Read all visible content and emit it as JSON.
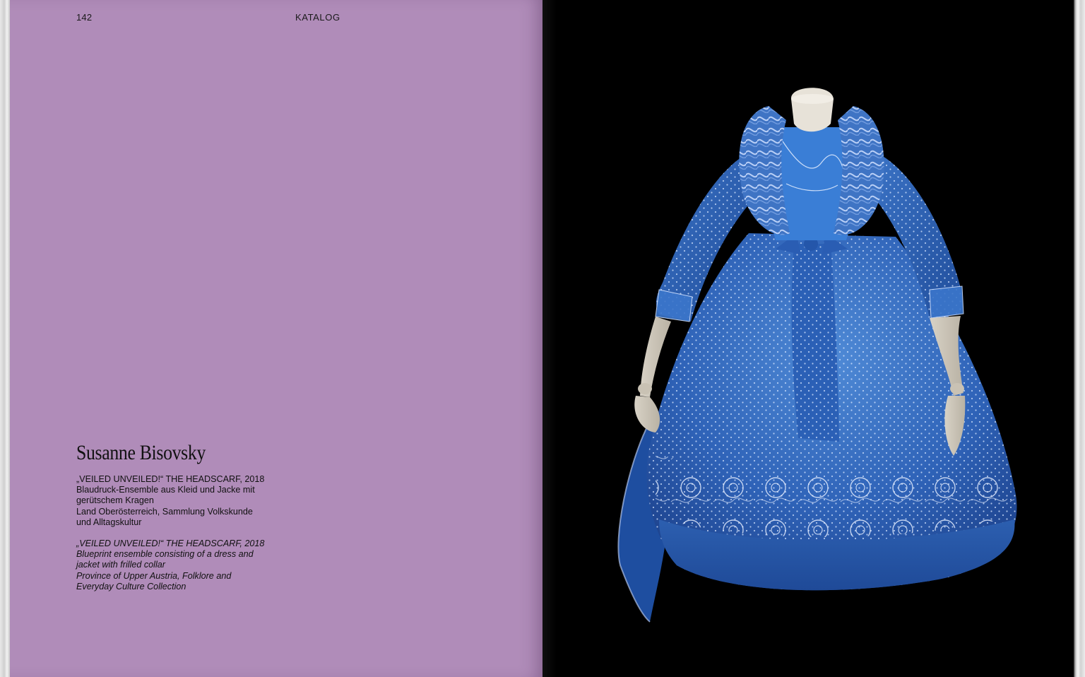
{
  "left_page": {
    "page_number": "142",
    "running_head": "KATALOG",
    "artist": "Susanne Bisovsky",
    "caption_de": [
      "„VEILED UNVEILED!“ THE HEADSCARF, 2018",
      "Blaudruck-Ensemble aus Kleid und Jacke mit",
      "gerütschem Kragen",
      "Land Oberösterreich, Sammlung Volkskunde",
      "und Alltagskultur"
    ],
    "caption_en": [
      "„VEILED UNVEILED!“ THE HEADSCARF, 2018",
      "Blueprint ensemble consisting of a dress and",
      "jacket with frilled collar",
      "Province of Upper Austria,  Folklore and",
      "Everyday Culture Collection"
    ],
    "background_color": "#b08cb9"
  },
  "right_page": {
    "photo": "blue-dress-on-mannequin",
    "background_color": "#000000",
    "dress_color": "#2f63b8"
  }
}
